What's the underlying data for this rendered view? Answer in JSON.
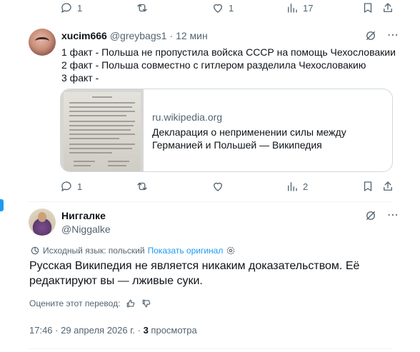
{
  "top_actions": {
    "replies": "1",
    "likes": "1",
    "views": "17"
  },
  "reply": {
    "name": "xucim666",
    "handle": "@greybags1",
    "separator": "·",
    "time": "12 мин",
    "lines": [
      "1 факт - Польша не пропустила войска СССР на помощь Чехословакии",
      "2 факт - Польша совместно с гитлером разделила Чехословакию",
      "3 факт -"
    ],
    "card": {
      "domain": "ru.wikipedia.org",
      "title": "Декларация о неприменении силы между Германией и Польшей — Википедия"
    },
    "actions": {
      "replies": "1",
      "retweets": "",
      "likes": "",
      "views": "2"
    }
  },
  "main_post": {
    "name": "Ниггалке",
    "handle": "@Niggalke",
    "source_language": "Исходный язык: польский",
    "show_original": "Показать оригинал",
    "text": "Русская Википедия не является никаким доказательством. Её редактируют вы — лживые суки.",
    "rate_translation": "Оцените этот перевод:",
    "timestamp": "17:46 · 29 апреля 2026 г. ·",
    "views_count": "3",
    "views_label": "просмотра"
  }
}
